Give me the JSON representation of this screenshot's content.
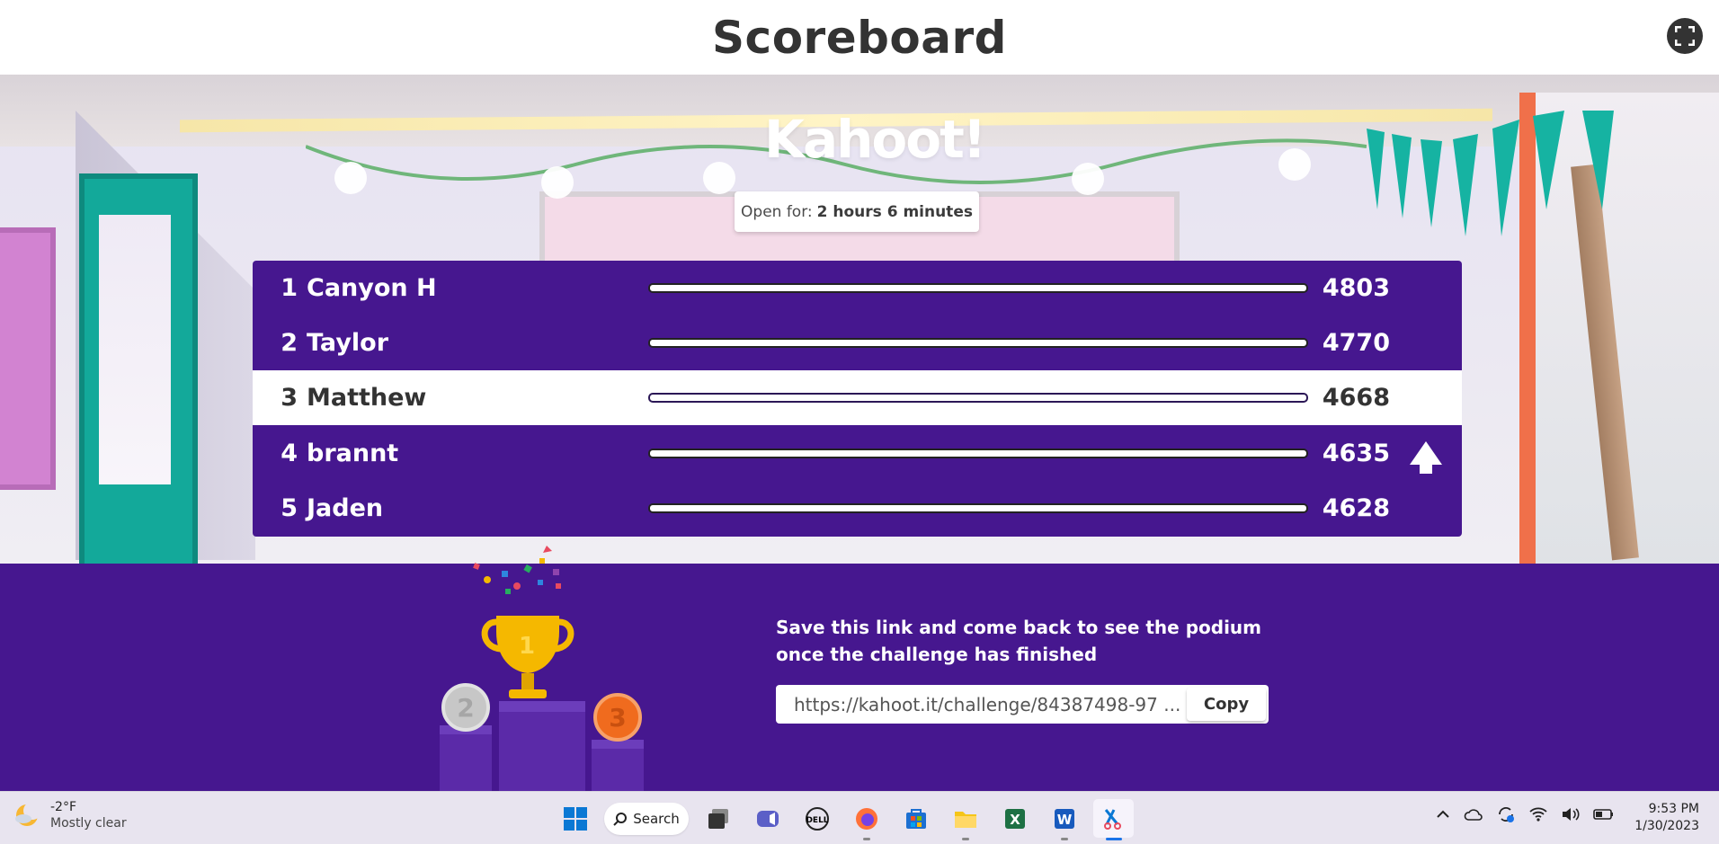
{
  "header": {
    "title": "Scoreboard"
  },
  "logo": {
    "text": "Kahoot!"
  },
  "open_for": {
    "label": "Open for:",
    "value": "2 hours 6 minutes"
  },
  "leaderboard": [
    {
      "rank": "1",
      "name": "Canyon H",
      "score": "4803",
      "highlighted": false
    },
    {
      "rank": "2",
      "name": "Taylor",
      "score": "4770",
      "highlighted": false
    },
    {
      "rank": "3",
      "name": "Matthew",
      "score": "4668",
      "highlighted": true
    },
    {
      "rank": "4",
      "name": "brannt",
      "score": "4635",
      "highlighted": false,
      "trend": "up"
    },
    {
      "rank": "5",
      "name": "Jaden",
      "score": "4628",
      "highlighted": false
    }
  ],
  "footer": {
    "save_text": "Save this link and come back to see the podium once the challenge has finished",
    "link": "https://kahoot.it/challenge/84387498-97 ...",
    "copy_label": "Copy",
    "podium_labels": [
      "1",
      "2",
      "3"
    ]
  },
  "taskbar": {
    "weather_temp": "-2°F",
    "weather_desc": "Mostly clear",
    "search_label": "Search",
    "time": "9:53 PM",
    "date": "1/30/2023",
    "apps": [
      "windows-start-icon",
      "task-view-icon",
      "teams-icon",
      "dell-icon",
      "firefox-icon",
      "store-icon",
      "file-explorer-icon",
      "excel-icon",
      "word-icon",
      "snipping-tool-icon"
    ]
  },
  "colors": {
    "brand_purple": "#46178f",
    "header_text": "#333333",
    "trophy_gold": "#f5b800"
  }
}
